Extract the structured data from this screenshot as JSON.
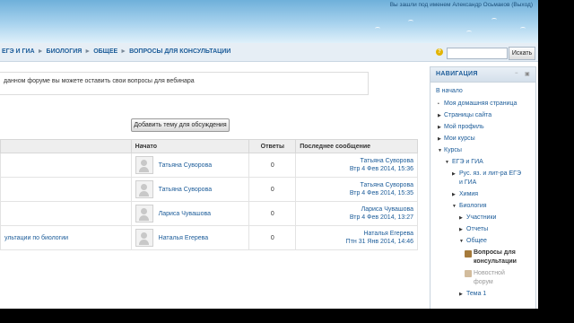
{
  "header": {
    "login_info": "Вы зашли под именем Александр Осьмаков (Выход)"
  },
  "breadcrumbs": [
    "ЕГЭ И ГИА",
    "БИОЛОГИЯ",
    "ОБЩЕЕ",
    "ВОПРОСЫ ДЛЯ КОНСУЛЬТАЦИИ"
  ],
  "search": {
    "value": "",
    "button": "Искать"
  },
  "intro_text": "данном форуме вы можете оставить свои вопросы для вебинара",
  "add_button": "Добавить тему для обсуждения",
  "table": {
    "headers": {
      "started": "Начато",
      "replies": "Ответы",
      "last": "Последнее сообщение"
    },
    "rows": [
      {
        "topic": "",
        "author": "Татьяна Суворова",
        "replies": "0",
        "last_author": "Татьяна Суворова",
        "last_date": "Втр 4 Фев 2014, 15:36"
      },
      {
        "topic": "",
        "author": "Татьяна Суворова",
        "replies": "0",
        "last_author": "Татьяна Суворова",
        "last_date": "Втр 4 Фев 2014, 15:35"
      },
      {
        "topic": "",
        "author": "Лариса Чувашова",
        "replies": "0",
        "last_author": "Лариса Чувашова",
        "last_date": "Втр 4 Фев 2014, 13:27"
      },
      {
        "topic": "ультации по биологии",
        "author": "Наталья Егерева",
        "replies": "0",
        "last_author": "Наталья Егерева",
        "last_date": "Птн 31 Янв 2014, 14:46"
      }
    ]
  },
  "nav": {
    "title": "НАВИГАЦИЯ",
    "home": "В начало",
    "my_home": "Моя домашняя страница",
    "site_pages": "Страницы сайта",
    "my_profile": "Мой профиль",
    "my_courses": "Мои курсы",
    "courses": "Курсы",
    "ege": "ЕГЭ и ГИА",
    "rus1": "Рус. яз. и лит-ра ЕГЭ",
    "rus2": "и ГИА",
    "chem": "Химия",
    "bio": "Биология",
    "participants": "Участники",
    "reports": "Отчеты",
    "general": "Общее",
    "forum1": "Вопросы для",
    "forum2": "консультации",
    "news1": "Новостной",
    "news2": "форум",
    "topic1": "Тема 1"
  },
  "colors": {
    "link": "#1c5c99",
    "header_top": "#6fb0da"
  }
}
